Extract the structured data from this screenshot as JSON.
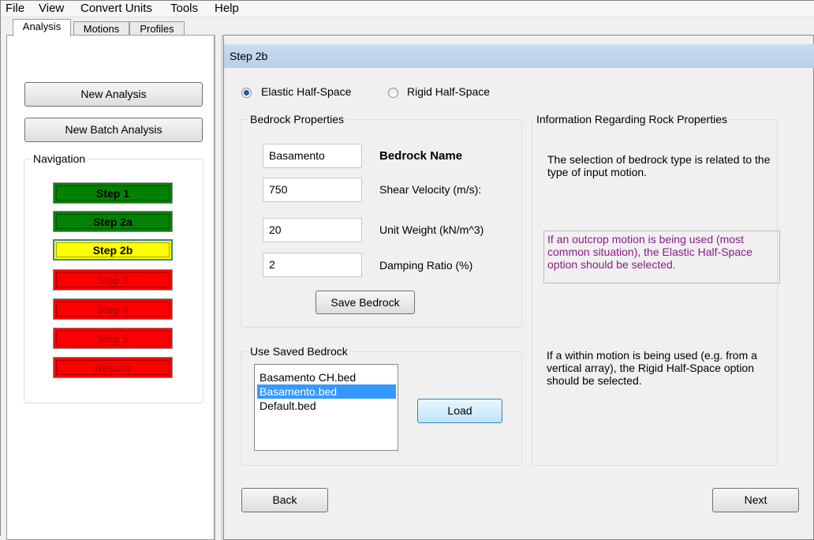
{
  "menu": {
    "items": [
      "File",
      "View",
      "Convert Units",
      "Tools",
      "Help"
    ]
  },
  "left_tabs": [
    "Analysis",
    "Motions",
    "Profiles"
  ],
  "left_buttons": {
    "new_analysis": "New Analysis",
    "new_batch": "New Batch Analysis"
  },
  "navigation": {
    "title": "Navigation",
    "steps": [
      {
        "label": "Step 1",
        "status": "complete",
        "color": "#038103"
      },
      {
        "label": "Step 2a",
        "status": "complete",
        "color": "#038103"
      },
      {
        "label": "Step 2b",
        "status": "current",
        "color": "#ffff00"
      },
      {
        "label": "Step 3",
        "status": "pending",
        "color": "#ff0000"
      },
      {
        "label": "Step 4",
        "status": "pending",
        "color": "#ff0000"
      },
      {
        "label": "Step 5",
        "status": "pending",
        "color": "#ff0000"
      },
      {
        "label": "Results",
        "status": "pending",
        "color": "#ff0000"
      }
    ]
  },
  "main": {
    "title": "Step 2b",
    "radio_options": [
      {
        "label": "Elastic Half-Space",
        "checked": true
      },
      {
        "label": "Rigid Half-Space",
        "checked": false
      }
    ],
    "bedrock_properties": {
      "title": "Bedrock Properties",
      "fields": [
        {
          "value": "Basamento",
          "label": "Bedrock Name"
        },
        {
          "value": "750",
          "label": "Shear Velocity (m/s):"
        },
        {
          "value": "20",
          "label": "Unit Weight (kN/m^3)"
        },
        {
          "value": "2",
          "label": "Damping Ratio (%)"
        }
      ],
      "save_button": "Save Bedrock"
    },
    "saved_bedrock": {
      "title": "Use Saved Bedrock",
      "items": [
        "Basamento CH.bed",
        "Basamento.bed",
        "Default.bed"
      ],
      "selected": "Basamento.bed",
      "load_button": "Load"
    },
    "info": {
      "title": "Information Regarding Rock Properties",
      "paragraph1": "The selection of bedrock type is related to the type of input motion.",
      "paragraph2": "If an outcrop motion is being used (most common situation), the Elastic Half-Space option should be selected.",
      "paragraph3": "If a within motion is being used (e.g. from a vertical array), the Rigid Half-Space option should be selected."
    },
    "back_button": "Back",
    "next_button": "Next"
  }
}
